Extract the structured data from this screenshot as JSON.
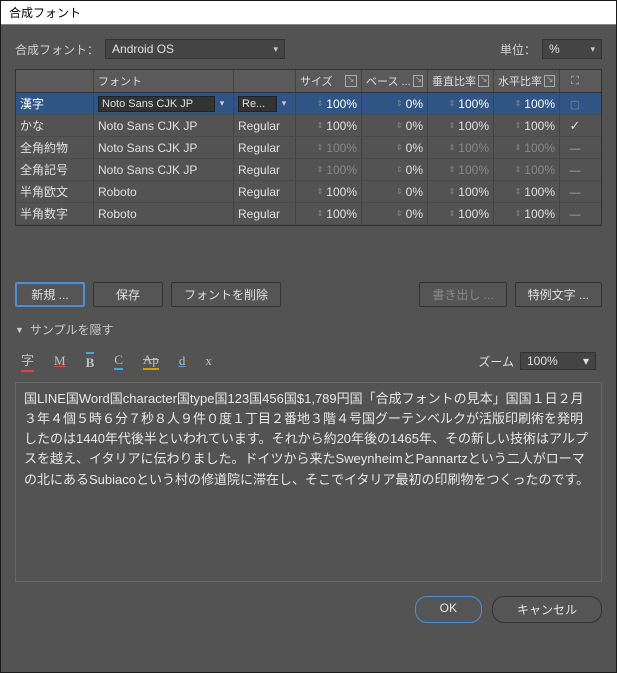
{
  "title": "合成フォント",
  "labels": {
    "compositeFont": "合成フォント：",
    "unit": "単位：",
    "zoom": "ズーム"
  },
  "selects": {
    "compositeFont": "Android OS",
    "unit": "%",
    "zoom": "100%"
  },
  "table": {
    "headers": {
      "category": "",
      "font": "フォント",
      "style": "",
      "size": "サイズ",
      "baseline": "ベース ...",
      "vert": "垂直比率",
      "horz": "水平比率"
    },
    "rows": [
      {
        "cat": "漢字",
        "font": "Noto Sans CJK JP",
        "style": "Re...",
        "size": "100%",
        "base": "0%",
        "vert": "100%",
        "horz": "100%",
        "mark": "box",
        "selected": true,
        "dimSize": true,
        "dimBase": true,
        "dimVert": true,
        "dimHorz": true,
        "editable": true
      },
      {
        "cat": "かな",
        "font": "Noto Sans CJK JP",
        "style": "Regular",
        "size": "100%",
        "base": "0%",
        "vert": "100%",
        "horz": "100%",
        "mark": "chk"
      },
      {
        "cat": "全角約物",
        "font": "Noto Sans CJK JP",
        "style": "Regular",
        "size": "100%",
        "base": "0%",
        "vert": "100%",
        "horz": "100%",
        "mark": "dash",
        "dimSize": true,
        "dimVert": true,
        "dimHorz": true
      },
      {
        "cat": "全角記号",
        "font": "Noto Sans CJK JP",
        "style": "Regular",
        "size": "100%",
        "base": "0%",
        "vert": "100%",
        "horz": "100%",
        "mark": "dash",
        "dimSize": true,
        "dimVert": true,
        "dimHorz": true
      },
      {
        "cat": "半角欧文",
        "font": "Roboto",
        "style": "Regular",
        "size": "100%",
        "base": "0%",
        "vert": "100%",
        "horz": "100%",
        "mark": "dash"
      },
      {
        "cat": "半角数字",
        "font": "Roboto",
        "style": "Regular",
        "size": "100%",
        "base": "0%",
        "vert": "100%",
        "horz": "100%",
        "mark": "dash"
      }
    ]
  },
  "buttons": {
    "new": "新規 ...",
    "save": "保存",
    "deleteFont": "フォントを削除",
    "export": "書き出し ...",
    "special": "特例文字 ...",
    "ok": "OK",
    "cancel": "キャンセル"
  },
  "collapse": {
    "label": "サンプルを隠す"
  },
  "toolbar": {
    "jp": "字",
    "m": "M",
    "b": "B",
    "c": "C",
    "ap": "Ap",
    "d": "d",
    "x": "x"
  },
  "sample": "国LINE国Word国character国type国123国456国$1,789円国「合成フォントの見本」国国１日２月３年４個５時６分７秒８人９件０度１丁目２番地３階４号国グーテンベルクが活版印刷術を発明したのは1440年代後半といわれています。それから約20年後の1465年、その新しい技術はアルプスを越え、イタリアに伝わりました。ドイツから来たSweynheimとPannartzという二人がローマの北にあるSubiacoという村の修道院に滞在し、そこでイタリア最初の印刷物をつくったのです。"
}
